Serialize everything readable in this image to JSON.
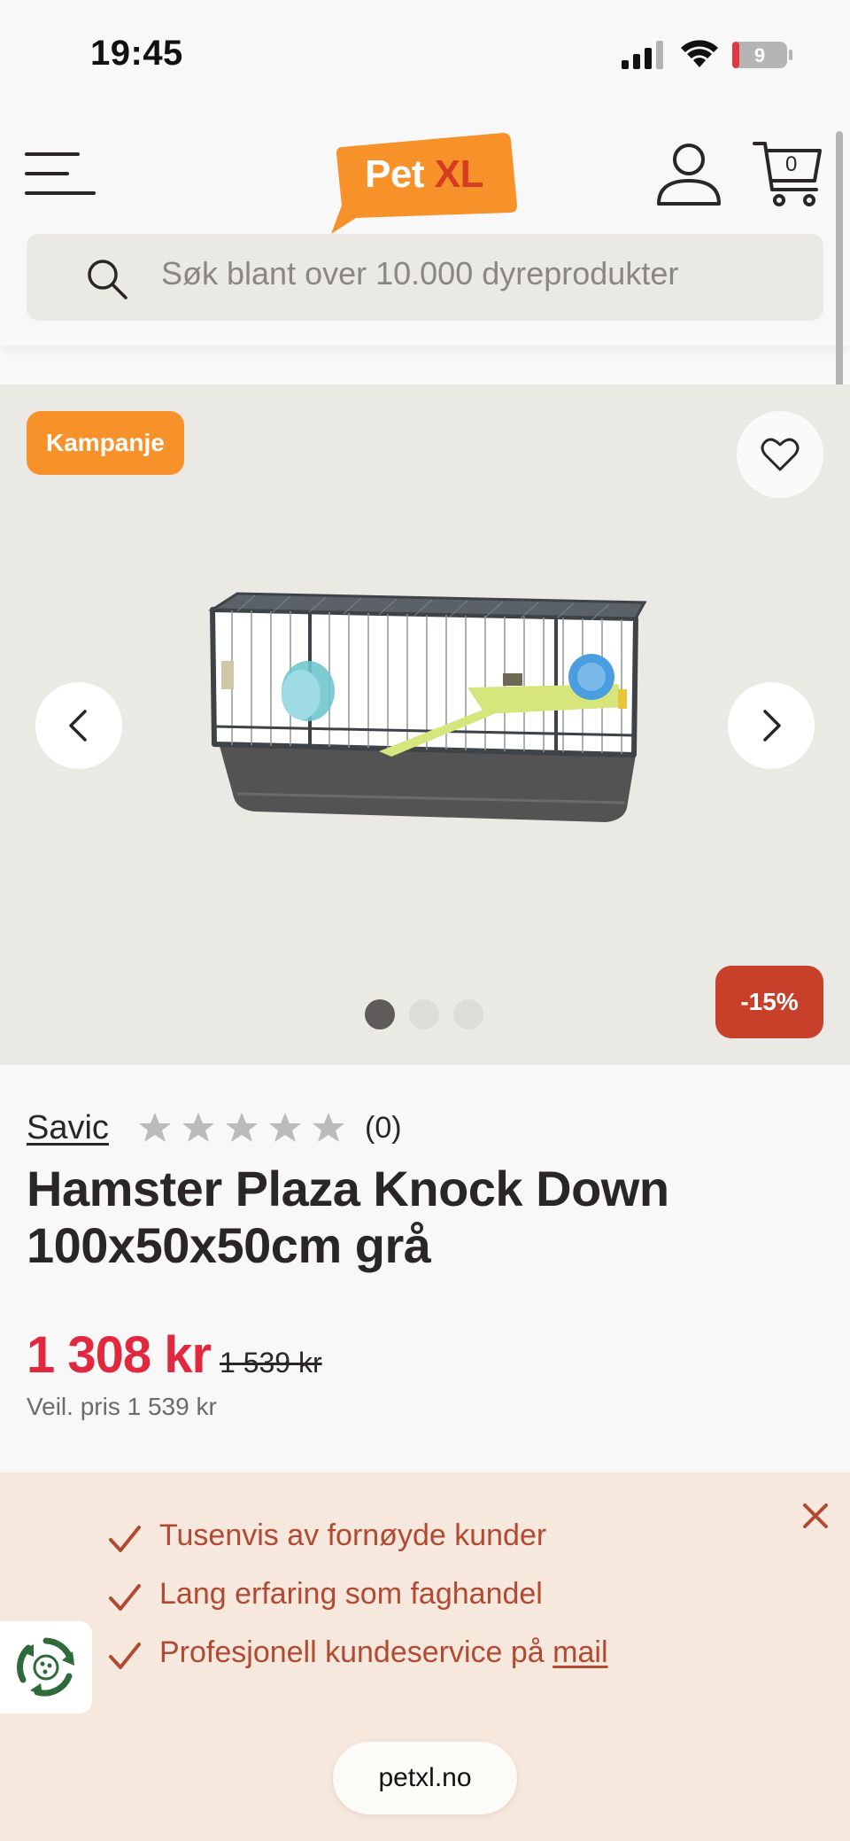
{
  "status_bar": {
    "time": "19:45",
    "battery_level": "9"
  },
  "header": {
    "logo": {
      "pet": "Pet",
      "xl": "XL"
    },
    "cart_count": "0",
    "search": {
      "placeholder": "Søk blant over 10.000 dyreprodukter"
    }
  },
  "gallery": {
    "badge_campaign": "Kampanje",
    "badge_discount": "-15%",
    "image_count": 3,
    "active_image": 1
  },
  "product": {
    "brand": "Savic",
    "rating": 0,
    "rating_max": 5,
    "review_count": "(0)",
    "title": "Hamster Plaza Knock Down 100x50x50cm grå",
    "price_now": "1 308 kr",
    "price_old": "1 539 kr",
    "price_reference": "Veil. pris 1 539 kr"
  },
  "usp": {
    "items": [
      "Tusenvis av fornøyde kunder",
      "Lang erfaring som faghandel",
      "Profesjonell kundeservice på"
    ],
    "link_text": "mail"
  },
  "browser": {
    "url": "petxl.no"
  },
  "colors": {
    "brand_orange": "#f7922a",
    "brand_red": "#d43d1f",
    "price_red": "#e2283e",
    "discount_badge": "#c8402a",
    "usp_text": "#b24a33",
    "usp_background": "#f6e8dc",
    "gallery_background": "#ebe9e4"
  },
  "icons": [
    "menu-icon",
    "user-icon",
    "cart-icon",
    "search-icon",
    "heart-icon",
    "chevron-left-icon",
    "chevron-right-icon",
    "star-icon",
    "check-icon",
    "close-icon",
    "recycle-icon"
  ]
}
